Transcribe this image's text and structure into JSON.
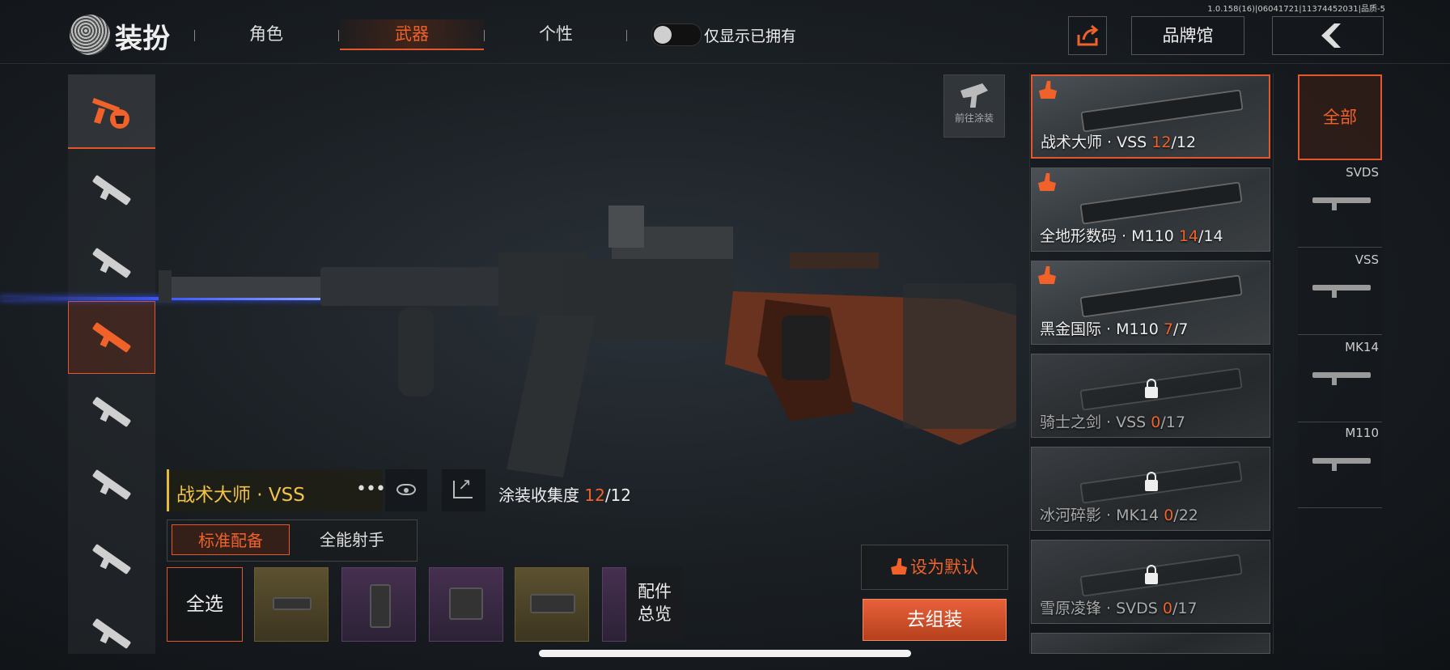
{
  "version_info": "1.0.158(16)|06041721|11374452031|品质-5",
  "header": {
    "title": "装扮",
    "tabs": [
      {
        "label": "角色",
        "active": false
      },
      {
        "label": "武器",
        "active": true
      },
      {
        "label": "个性",
        "active": false
      }
    ],
    "toggle_label": "仅显示已拥有",
    "toggle_on": false,
    "brand_label": "品牌馆"
  },
  "left_categories": [
    "paint-brush-gun-icon",
    "assault-rifle-icon",
    "smg-icon",
    "sniper-rifle-icon",
    "bolt-rifle-icon",
    "rifle-icon",
    "shotgun-icon",
    "lmg-icon"
  ],
  "paint_link_label": "前往涂装",
  "current": {
    "name": "战术大师 · VSS",
    "collect_label": "涂装收集度",
    "collect_have": "12",
    "collect_total": "/12"
  },
  "loadout_tabs": [
    {
      "label": "标准配备",
      "active": true
    },
    {
      "label": "全能射手",
      "active": false
    }
  ],
  "select_all_label": "全选",
  "attachments": [
    "gold",
    "purple",
    "purple",
    "gold"
  ],
  "overview_line1": "配件",
  "overview_line2": "总览",
  "set_default_label": "设为默认",
  "assemble_label": "去组装",
  "skins": [
    {
      "name": "战术大师 · VSS ",
      "have": "12",
      "total": "/12",
      "active": true,
      "locked": false
    },
    {
      "name": "全地形数码 · M110 ",
      "have": "14",
      "total": "/14",
      "active": false,
      "locked": false
    },
    {
      "name": "黑金国际 · M110 ",
      "have": "7",
      "total": "/7",
      "active": false,
      "locked": false
    },
    {
      "name": "骑士之剑 · VSS ",
      "have": "0",
      "total": "/17",
      "active": false,
      "locked": true
    },
    {
      "name": "冰河碎影 · MK14 ",
      "have": "0",
      "total": "/22",
      "active": false,
      "locked": true
    },
    {
      "name": "雪原凌锋 · SVDS ",
      "have": "0",
      "total": "/17",
      "active": false,
      "locked": true
    }
  ],
  "filter_all_label": "全部",
  "filters": [
    "SVDS",
    "VSS",
    "MK14",
    "M110"
  ],
  "colors": {
    "accent": "#e4572b",
    "gold": "#f1c34a"
  }
}
